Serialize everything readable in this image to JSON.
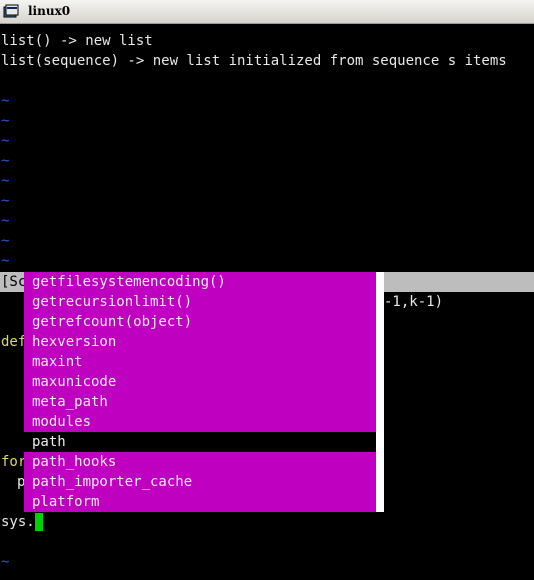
{
  "window": {
    "title": "linux0"
  },
  "buffer": {
    "line1": "list() -> new list",
    "line2": "list(sequence) -> new list initialized from sequence s items",
    "tilde": "~"
  },
  "status": {
    "left": "[Sc",
    "right": "-1,k-1)"
  },
  "code": {
    "def_kw": "def",
    "for_kw": "for",
    "p_frag": "p",
    "prompt": "sys."
  },
  "completion": {
    "items": [
      "getfilesystemencoding()",
      "getrecursionlimit()",
      "getrefcount(object)",
      "hexversion",
      "maxint",
      "maxunicode",
      "meta_path",
      "modules",
      "path",
      "path_hooks",
      "path_importer_cache",
      "platform"
    ],
    "selected_index": 8
  },
  "colors": {
    "popup_bg": "#c000c0",
    "cursor": "#00d000",
    "tilde": "#2b57d6"
  }
}
